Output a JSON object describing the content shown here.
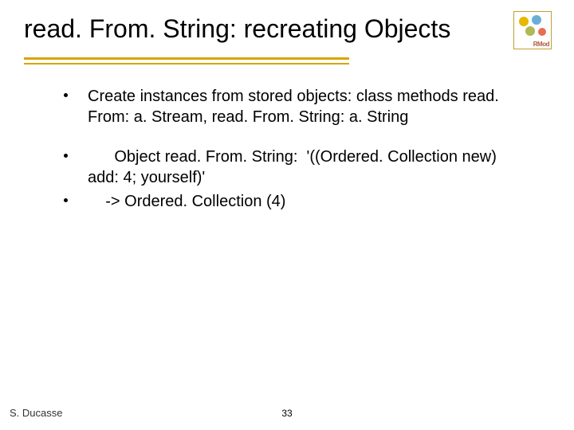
{
  "title": "read. From. String: recreating Objects",
  "logo": {
    "label": "RMod"
  },
  "bullets": [
    {
      "text": "Create instances from stored objects: class methods read. From: a. Stream, read. From. String: a. String"
    },
    {
      "text": "      Object read. From. String:  '((Ordered. Collection new) add: 4; yourself)'"
    },
    {
      "text": "    -> Ordered. Collection (4)"
    }
  ],
  "footer": {
    "author": "S. Ducasse",
    "page": "33"
  }
}
